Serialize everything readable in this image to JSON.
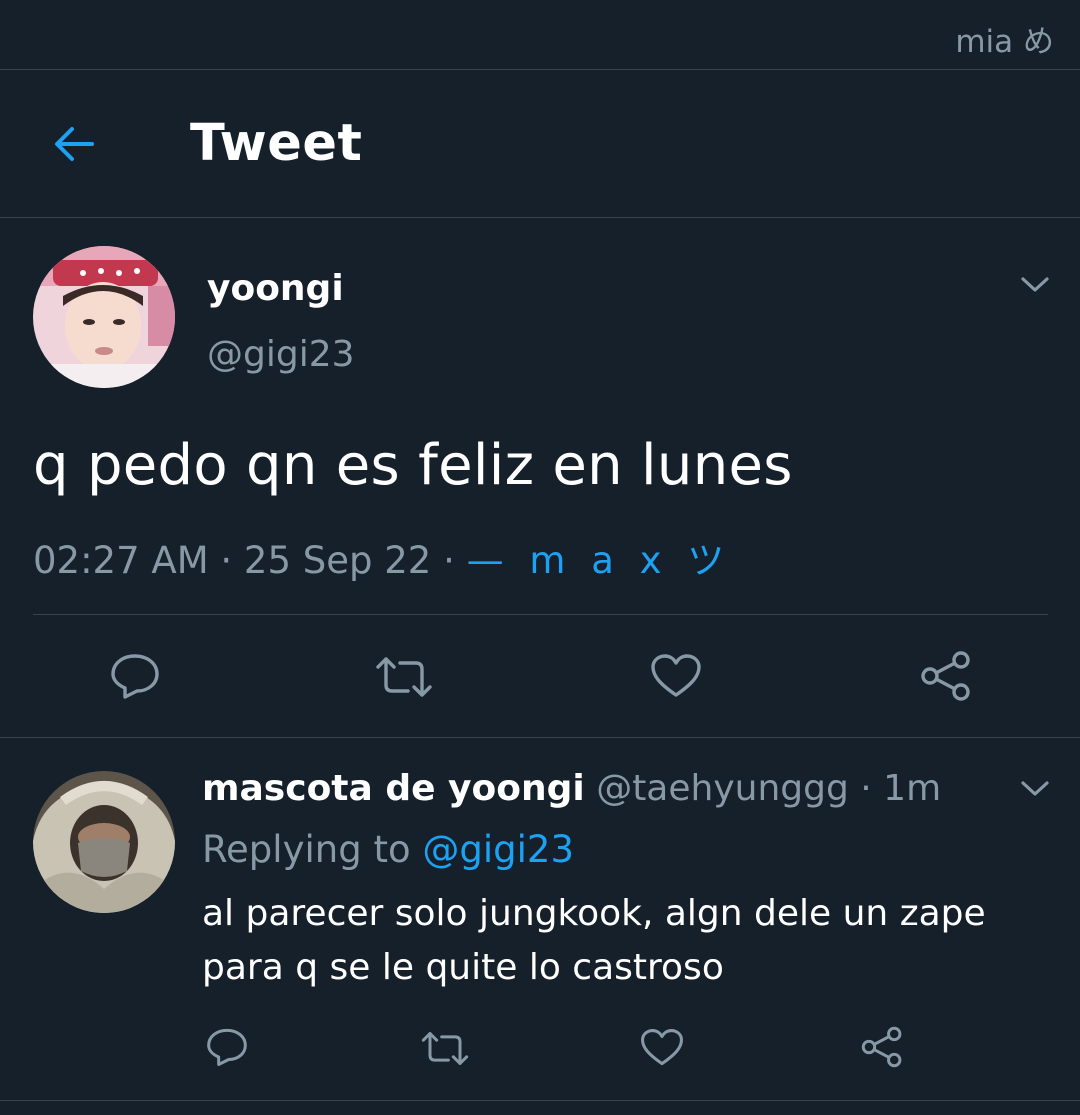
{
  "status_bar": {
    "label": "mia め"
  },
  "header": {
    "title": "Tweet",
    "back_icon": "arrow-left-icon"
  },
  "tweet": {
    "author_name": "yoongi",
    "author_handle": "@gigi23",
    "text": "q pedo qn es feliz en lunes",
    "time": "02:27 AM",
    "date": "25 Sep 22",
    "source": "— m a x ツ",
    "actions": [
      "reply-icon",
      "retweet-icon",
      "like-icon",
      "share-icon"
    ]
  },
  "reply": {
    "author_name": "mascota de yoongi",
    "author_handle": "@taehyunggg",
    "time": "1m",
    "replying_prefix": "Replying to",
    "replying_to": "@gigi23",
    "text": "al parecer solo jungkook, algn dele un zape para q se le quite lo castroso",
    "actions": [
      "reply-icon",
      "retweet-icon",
      "like-icon",
      "share-icon"
    ]
  },
  "colors": {
    "background": "#15202b",
    "accent": "#1da1f2",
    "secondary_text": "#8899a6",
    "divider": "#38444d"
  }
}
